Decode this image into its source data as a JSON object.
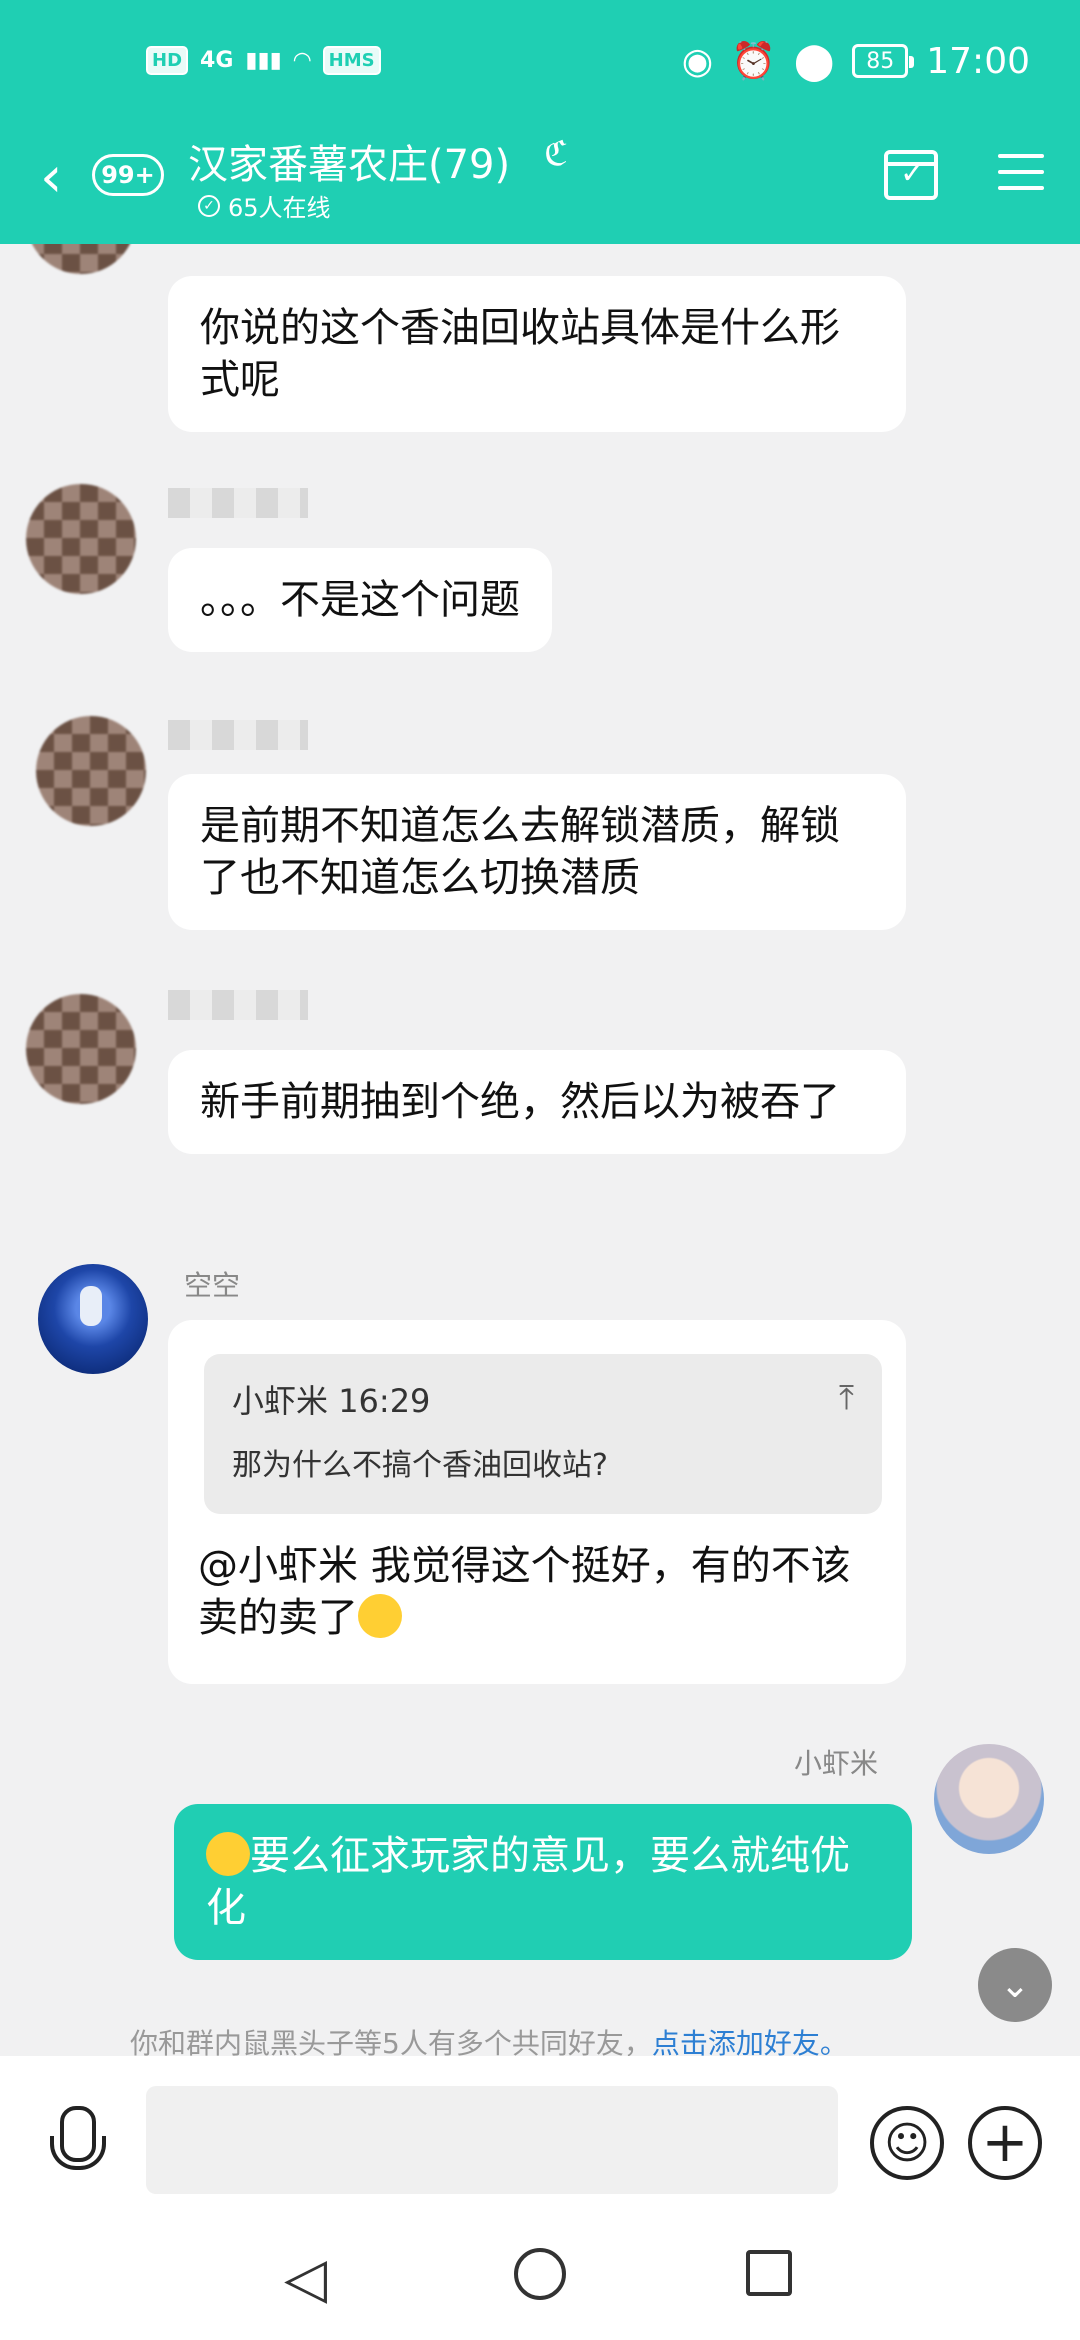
{
  "status_bar": {
    "left_chips": [
      "HD",
      "4G",
      "HMS"
    ],
    "time": "17:00",
    "battery": "85"
  },
  "header": {
    "unread_badge": "99+",
    "group_title": "汉家番薯农庄(79)",
    "online_text": "65人在线"
  },
  "messages": [
    {
      "text": "你说的这个香油回收站具体是什么形式呢"
    },
    {
      "text": "。。。不是这个问题"
    },
    {
      "text": "是前期不知道怎么去解锁潜质，解锁了也不知道怎么切换潜质"
    },
    {
      "text": "新手前期抽到个绝，然后以为被吞了"
    },
    {
      "sender": "空空",
      "reply_to": {
        "sender": "小虾米",
        "time": "16:29",
        "text": "那为什么不搞个香油回收站?"
      },
      "text": "@小虾米 我觉得这个挺好，有的不该卖的卖了"
    },
    {
      "sender": "小虾米",
      "text": "要么征求玩家的意见，要么就纯优化",
      "mine": true
    }
  ],
  "friend_tip": {
    "text": "你和群内鼠黑头子等5人有多个共同好友，",
    "link": "点击添加好友。"
  },
  "input": {
    "placeholder": ""
  }
}
